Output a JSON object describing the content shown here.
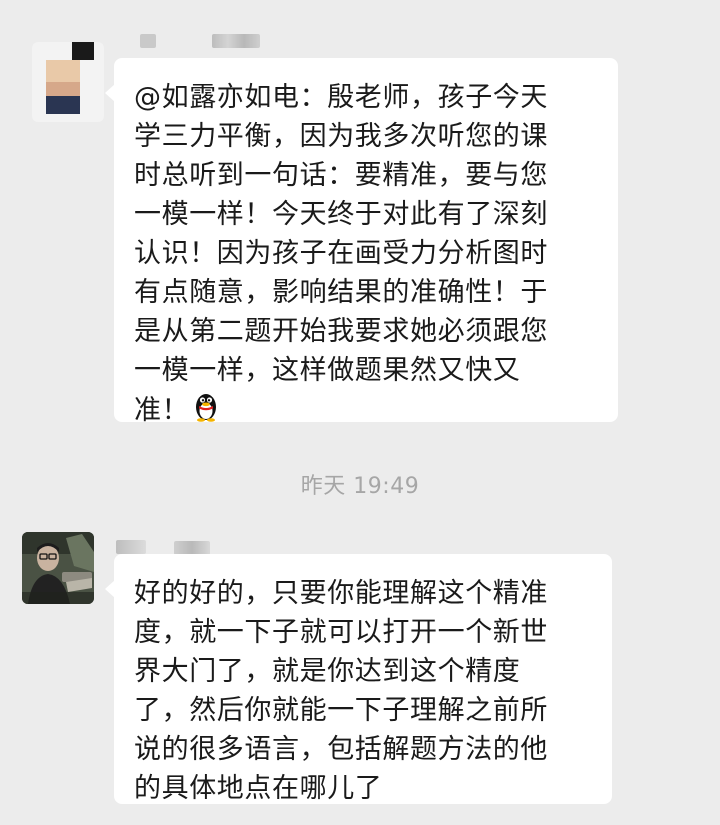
{
  "messages": [
    {
      "lines": [
        "@如露亦如电：殷老师，孩子今天",
        "学三力平衡，因为我多次听您的课",
        "时总听到一句话：要精准，要与您",
        "一模一样！今天终于对此有了深刻",
        "认识！因为孩子在画受力分析图时",
        "有点随意，影响结果的准确性！于",
        "是从第二题开始我要求她必须跟您",
        "一模一样，这样做题果然又快又",
        "准！"
      ],
      "emoji": "qq-penguin-icon"
    },
    {
      "lines": [
        "好的好的，只要你能理解这个精准",
        "度，就一下子就可以打开一个新世",
        "界大门了，就是你达到这个精度",
        "了，然后你就能一下子理解之前所",
        "说的很多语言，包括解题方法的他",
        "的具体地点在哪儿了"
      ]
    }
  ],
  "timestamp": "昨天 19:49",
  "colors": {
    "background": "#ececec",
    "bubble": "#ffffff",
    "text": "#1a1a1a",
    "timestamp": "#a6a6a6"
  }
}
